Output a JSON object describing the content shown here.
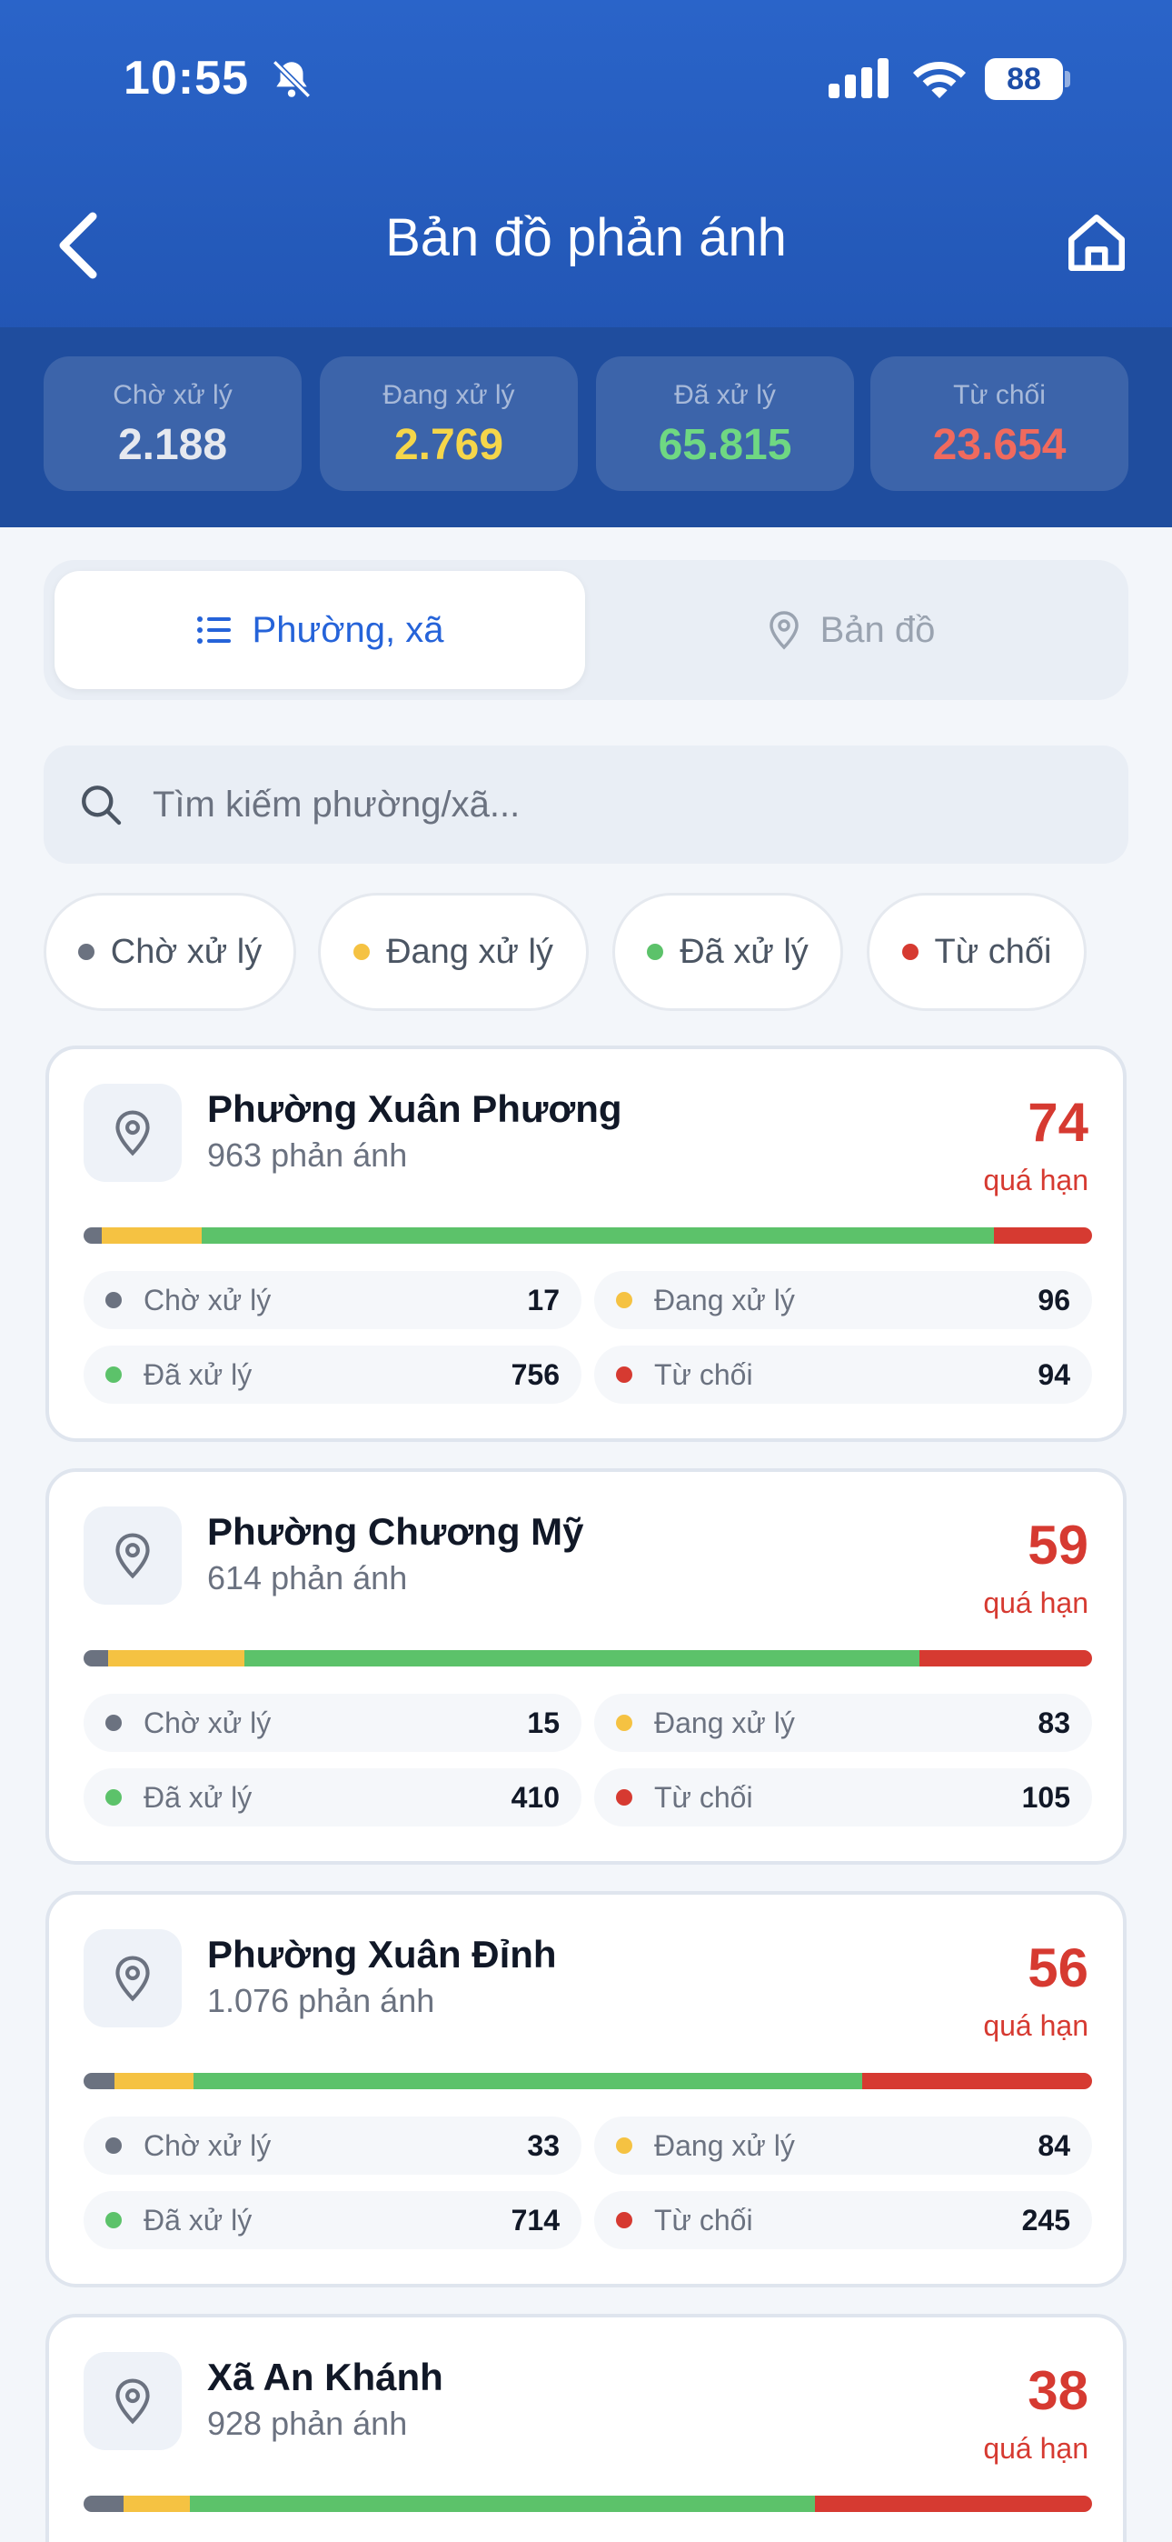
{
  "status_bar": {
    "time": "10:55",
    "battery": "88"
  },
  "nav": {
    "title": "Bản đồ phản ánh"
  },
  "summary": [
    {
      "label": "Chờ xử lý",
      "value": "2.188",
      "color": "#e6e9ef"
    },
    {
      "label": "Đang xử lý",
      "value": "2.769",
      "color": "#f5d64a"
    },
    {
      "label": "Đã xử lý",
      "value": "65.815",
      "color": "#6fd882"
    },
    {
      "label": "Từ chối",
      "value": "23.654",
      "color": "#f06a5e"
    }
  ],
  "tabs": {
    "list_label": "Phường, xã",
    "map_label": "Bản đồ"
  },
  "search": {
    "placeholder": "Tìm kiếm phường/xã..."
  },
  "filters": [
    "Chờ xử lý",
    "Đang xử lý",
    "Đã xử lý",
    "Từ chối"
  ],
  "status_colors": {
    "pending": "#6b7280",
    "processing": "#f5c242",
    "done": "#5cc26a",
    "rejected": "#d63a31"
  },
  "overdue_label": "quá hạn",
  "wards": [
    {
      "name": "Phường Xuân Phương",
      "count": "963 phản ánh",
      "overdue": "74",
      "stats": {
        "pending": {
          "label": "Chờ xử lý",
          "value": "17"
        },
        "processing": {
          "label": "Đang xử lý",
          "value": "96"
        },
        "done": {
          "label": "Đã xử lý",
          "value": "756"
        },
        "rejected": {
          "label": "Từ chối",
          "value": "94"
        }
      }
    },
    {
      "name": "Phường Chương Mỹ",
      "count": "614 phản ánh",
      "overdue": "59",
      "stats": {
        "pending": {
          "label": "Chờ xử lý",
          "value": "15"
        },
        "processing": {
          "label": "Đang xử lý",
          "value": "83"
        },
        "done": {
          "label": "Đã xử lý",
          "value": "410"
        },
        "rejected": {
          "label": "Từ chối",
          "value": "105"
        }
      }
    },
    {
      "name": "Phường Xuân Đỉnh",
      "count": "1.076 phản ánh",
      "overdue": "56",
      "stats": {
        "pending": {
          "label": "Chờ xử lý",
          "value": "33"
        },
        "processing": {
          "label": "Đang xử lý",
          "value": "84"
        },
        "done": {
          "label": "Đã xử lý",
          "value": "714"
        },
        "rejected": {
          "label": "Từ chối",
          "value": "245"
        }
      }
    },
    {
      "name": "Xã An Khánh",
      "count": "928 phản ánh",
      "overdue": "38"
    }
  ]
}
